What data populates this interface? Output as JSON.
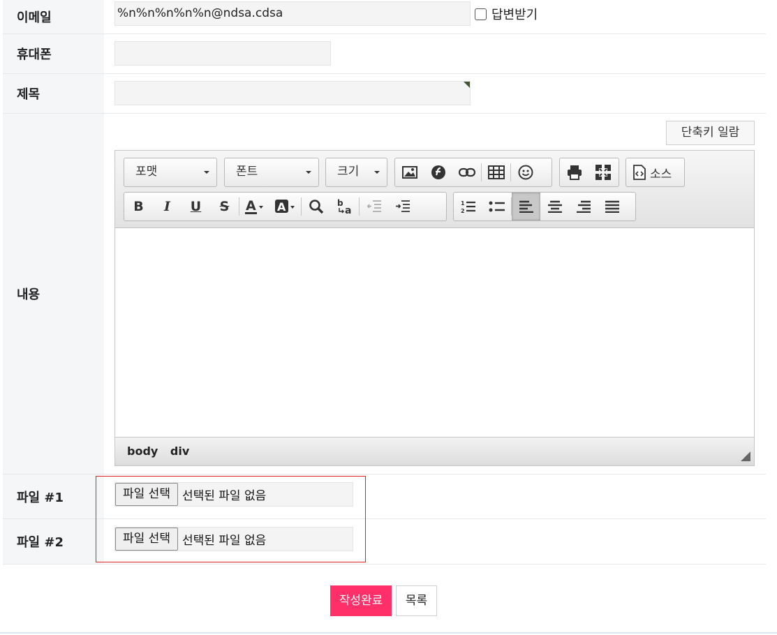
{
  "form": {
    "email": {
      "label": "이메일",
      "value": "%n%n%n%n%n@ndsa.cdsa",
      "reply_label": "답변받기",
      "reply_checked": false
    },
    "phone": {
      "label": "휴대폰",
      "value": ""
    },
    "subject": {
      "label": "제목",
      "value": ""
    },
    "content": {
      "label": "내용",
      "shortcut_button": "단축키 일람"
    },
    "file1": {
      "label": "파일 #1",
      "button": "파일 선택",
      "status": "선택된 파일 없음"
    },
    "file2": {
      "label": "파일 #2",
      "button": "파일 선택",
      "status": "선택된 파일 없음"
    }
  },
  "editor": {
    "format_combo": "포맷",
    "font_combo": "폰트",
    "size_combo": "크기",
    "source_label": "소스",
    "toolbar_icons": [
      "image",
      "flash",
      "link",
      "table",
      "smiley",
      "print",
      "maximize",
      "source",
      "bold",
      "italic",
      "underline",
      "strikethrough",
      "text-color",
      "background-color",
      "find",
      "replace",
      "outdent",
      "indent",
      "numbered-list",
      "bulleted-list",
      "align-left",
      "align-center",
      "align-right",
      "justify"
    ],
    "active_alignment": "align-left",
    "status_path": [
      "body",
      "div"
    ]
  },
  "actions": {
    "submit": "작성완료",
    "list": "목록"
  },
  "colors": {
    "submit_bg": "#ff2f69",
    "highlight_border": "#e02020",
    "label_bg": "#f4f6f8"
  }
}
